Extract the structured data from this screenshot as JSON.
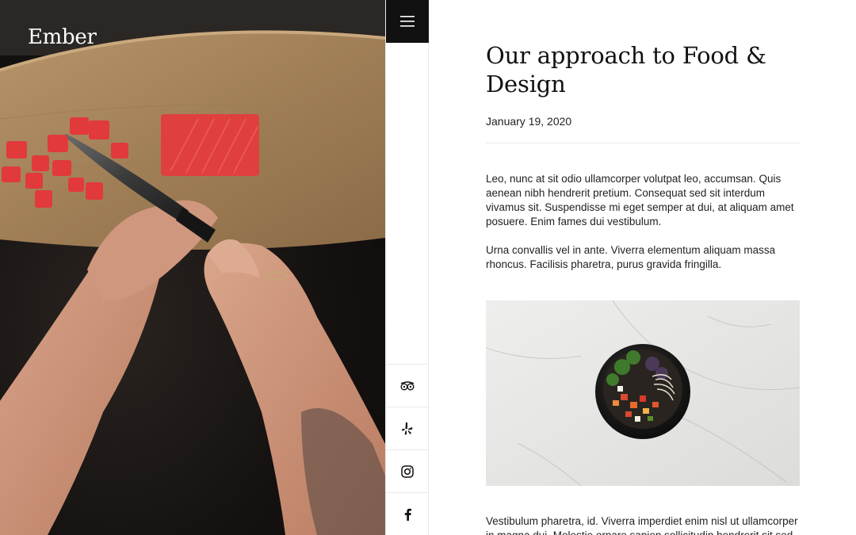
{
  "brand": {
    "name": "Ember"
  },
  "nav": {
    "menu_icon": "hamburger-icon"
  },
  "social": [
    {
      "name": "TripAdvisor",
      "icon": "tripadvisor-icon"
    },
    {
      "name": "Yelp",
      "icon": "yelp-icon"
    },
    {
      "name": "Instagram",
      "icon": "instagram-icon"
    },
    {
      "name": "Facebook",
      "icon": "facebook-icon"
    }
  ],
  "article": {
    "title": "Our approach to Food & Design",
    "date": "January 19, 2020",
    "paragraphs": [
      "Leo, nunc at sit odio ullamcorper volutpat leo, accumsan. Quis aenean nibh hendrerit pretium. Consequat sed sit interdum vivamus sit. Suspendisse mi eget semper at dui, at aliquam amet posuere. Enim fames dui vestibulum.",
      "Urna convallis vel in ante. Viverra elementum aliquam massa rhoncus. Facilisis pharetra, purus gravida fringilla.",
      "Vestibulum pharetra, id. Viverra imperdiet enim nisl ut ullamcorper in magna dui. Molestie ornare sapien sollicitudin hendrerit sit sed"
    ]
  },
  "colors": {
    "rail_dark": "#111111",
    "text": "#222222",
    "divider": "#e8e8e8"
  }
}
